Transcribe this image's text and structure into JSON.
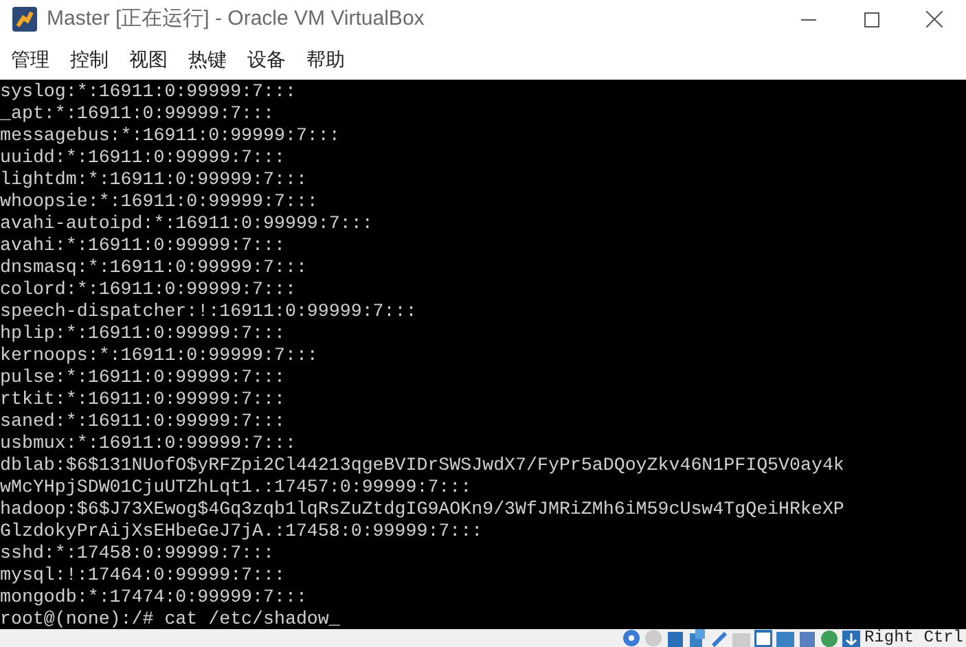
{
  "window": {
    "title": "Master [正在运行] - Oracle VM VirtualBox"
  },
  "menu": [
    "管理",
    "控制",
    "视图",
    "热键",
    "设备",
    "帮助"
  ],
  "terminal": {
    "lines": [
      "syslog:*:16911:0:99999:7:::",
      "_apt:*:16911:0:99999:7:::",
      "messagebus:*:16911:0:99999:7:::",
      "uuidd:*:16911:0:99999:7:::",
      "lightdm:*:16911:0:99999:7:::",
      "whoopsie:*:16911:0:99999:7:::",
      "avahi-autoipd:*:16911:0:99999:7:::",
      "avahi:*:16911:0:99999:7:::",
      "dnsmasq:*:16911:0:99999:7:::",
      "colord:*:16911:0:99999:7:::",
      "speech-dispatcher:!:16911:0:99999:7:::",
      "hplip:*:16911:0:99999:7:::",
      "kernoops:*:16911:0:99999:7:::",
      "pulse:*:16911:0:99999:7:::",
      "rtkit:*:16911:0:99999:7:::",
      "saned:*:16911:0:99999:7:::",
      "usbmux:*:16911:0:99999:7:::",
      "dblab:$6$131NUofO$yRFZpi2Cl44213qgeBVIDrSWSJwdX7/FyPr5aDQoyZkv46N1PFIQ5V0ay4k",
      "wMcYHpjSDW01CjuUTZhLqt1.:17457:0:99999:7:::",
      "hadoop:$6$J73XEwog$4Gq3zqb1lqRsZuZtdgIG9AOKn9/3WfJMRiZMh6iM59cUsw4TgQeiHRkeXP",
      "GlzdokyPrAijXsEHbeGeJ7jA.:17458:0:99999:7:::",
      "sshd:*:17458:0:99999:7:::",
      "mysql:!:17464:0:99999:7:::",
      "mongodb:*:17474:0:99999:7:::",
      "root@(none):/# cat /etc/shadow_"
    ]
  },
  "status_bar": {
    "host_key": "Right Ctrl"
  }
}
